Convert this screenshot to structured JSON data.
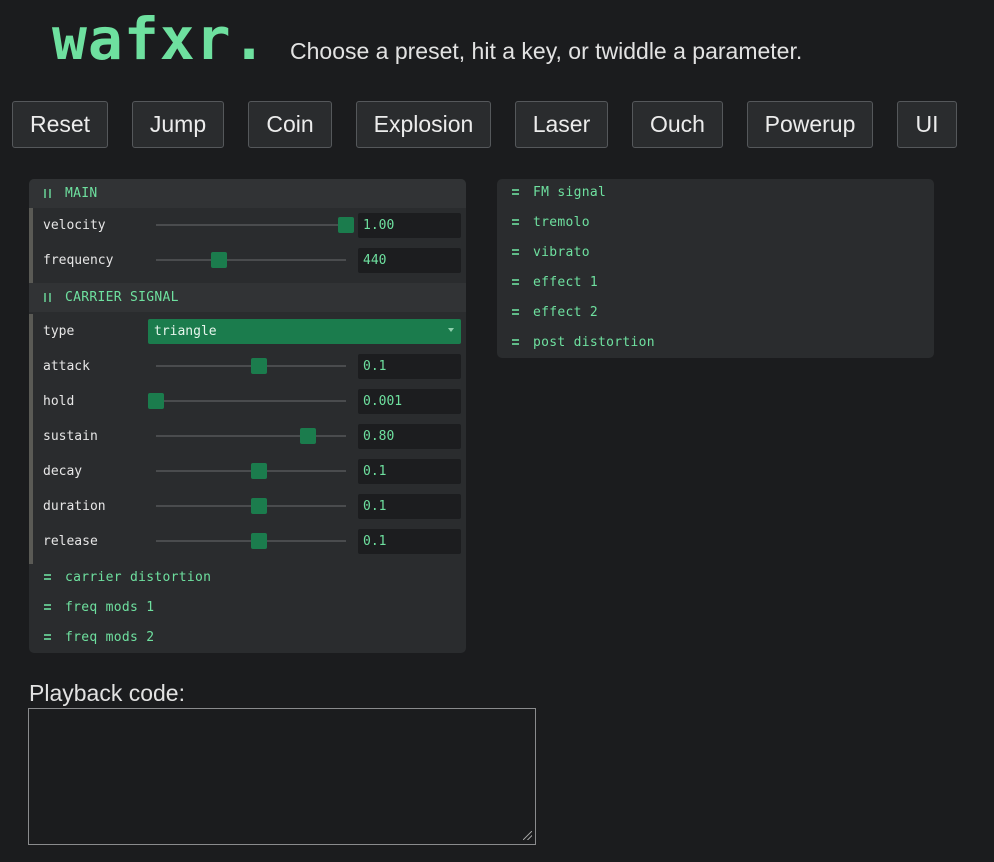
{
  "header": {
    "logo": "wafxr.",
    "tagline": "Choose a preset, hit a key, or twiddle a parameter."
  },
  "presets": [
    "Reset",
    "Jump",
    "Coin",
    "Explosion",
    "Laser",
    "Ouch",
    "Powerup",
    "UI"
  ],
  "main": {
    "title": "MAIN",
    "velocity": {
      "label": "velocity",
      "value": "1.00",
      "fraction": 1.0
    },
    "frequency": {
      "label": "frequency",
      "value": "440",
      "fraction": 0.33
    }
  },
  "carrier": {
    "title": "CARRIER SIGNAL",
    "type": {
      "label": "type",
      "value": "triangle"
    },
    "attack": {
      "label": "attack",
      "value": "0.1",
      "fraction": 0.54
    },
    "hold": {
      "label": "hold",
      "value": "0.001",
      "fraction": 0.0
    },
    "sustain": {
      "label": "sustain",
      "value": "0.80",
      "fraction": 0.8
    },
    "decay": {
      "label": "decay",
      "value": "0.1",
      "fraction": 0.54
    },
    "duration": {
      "label": "duration",
      "value": "0.1",
      "fraction": 0.54
    },
    "release": {
      "label": "release",
      "value": "0.1",
      "fraction": 0.54
    }
  },
  "left_folders": [
    "carrier distortion",
    "freq mods 1",
    "freq mods 2"
  ],
  "right_folders": [
    "FM signal",
    "tremolo",
    "vibrato",
    "effect 1",
    "effect 2",
    "post distortion"
  ],
  "playback": {
    "label": "Playback code:",
    "code": ""
  },
  "colors": {
    "accent": "#6ee09f",
    "slider_thumb": "#1b7c4d",
    "background": "#1b1c1e",
    "panel": "#2a2c2e"
  }
}
